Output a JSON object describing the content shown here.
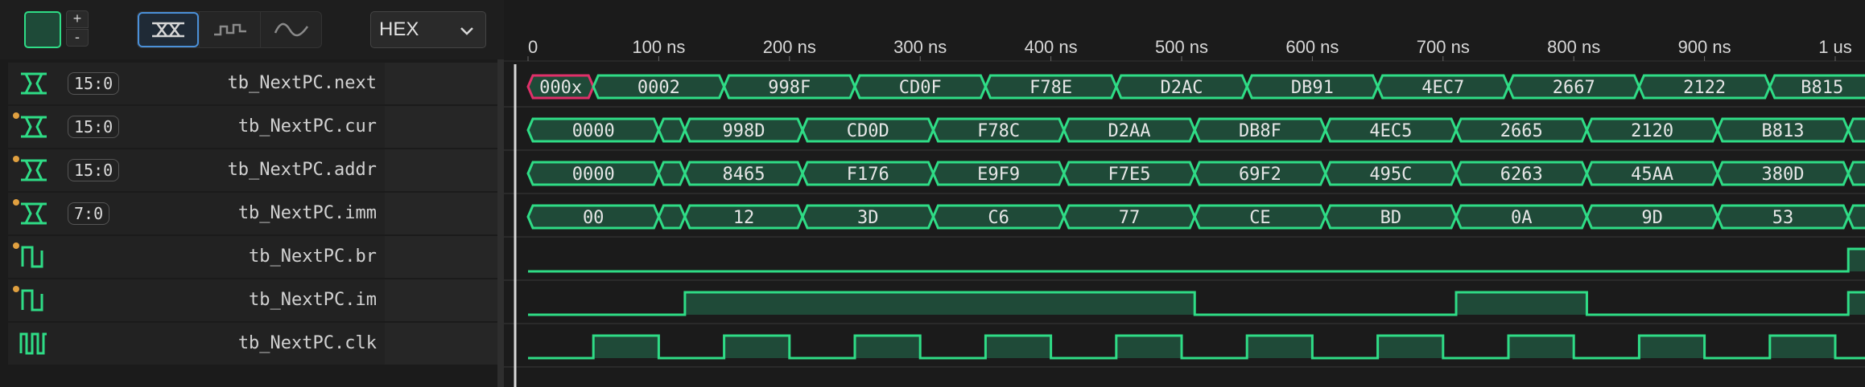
{
  "toolbar": {
    "plus": "+",
    "minus": "-",
    "radix": "HEX",
    "modes": [
      "bus-icon",
      "step-icon",
      "analog-icon"
    ]
  },
  "colors": {
    "wave": "#2fdc86",
    "wave_fill": "#1f4a38",
    "highlight": "#e0306a",
    "cursor": "#d8d8d8",
    "dot": "#e0a040"
  },
  "timeline": {
    "unit": "ns",
    "start": 0,
    "end": 1000,
    "ticks": [
      "0",
      "100 ns",
      "200 ns",
      "300 ns",
      "400 ns",
      "500 ns",
      "600 ns",
      "700 ns",
      "800 ns",
      "900 ns",
      "1 us"
    ]
  },
  "signals": [
    {
      "name": "tb_NextPC.next",
      "range": "15:0",
      "type": "bus",
      "dot": false,
      "segments": [
        [
          0,
          50,
          "000x"
        ],
        [
          50,
          150,
          "0002"
        ],
        [
          150,
          250,
          "998F"
        ],
        [
          250,
          350,
          "CD0F"
        ],
        [
          350,
          450,
          "F78E"
        ],
        [
          450,
          550,
          "D2AC"
        ],
        [
          550,
          650,
          "DB91"
        ],
        [
          650,
          750,
          "4EC7"
        ],
        [
          750,
          850,
          "2667"
        ],
        [
          850,
          950,
          "2122"
        ],
        [
          950,
          1030,
          "B815"
        ]
      ]
    },
    {
      "name": "tb_NextPC.cur",
      "range": "15:0",
      "type": "bus",
      "dot": true,
      "segments": [
        [
          0,
          100,
          "0000"
        ],
        [
          100,
          120,
          ""
        ],
        [
          120,
          210,
          "998D"
        ],
        [
          210,
          310,
          "CD0D"
        ],
        [
          310,
          410,
          "F78C"
        ],
        [
          410,
          510,
          "D2AA"
        ],
        [
          510,
          610,
          "DB8F"
        ],
        [
          610,
          710,
          "4EC5"
        ],
        [
          710,
          810,
          "2665"
        ],
        [
          810,
          910,
          "2120"
        ],
        [
          910,
          1010,
          "B813"
        ],
        [
          1010,
          1030,
          ""
        ]
      ]
    },
    {
      "name": "tb_NextPC.addr",
      "range": "15:0",
      "type": "bus",
      "dot": true,
      "segments": [
        [
          0,
          100,
          "0000"
        ],
        [
          100,
          120,
          ""
        ],
        [
          120,
          210,
          "8465"
        ],
        [
          210,
          310,
          "F176"
        ],
        [
          310,
          410,
          "E9F9"
        ],
        [
          410,
          510,
          "F7E5"
        ],
        [
          510,
          610,
          "69F2"
        ],
        [
          610,
          710,
          "495C"
        ],
        [
          710,
          810,
          "6263"
        ],
        [
          810,
          910,
          "45AA"
        ],
        [
          910,
          1010,
          "380D"
        ],
        [
          1010,
          1030,
          ""
        ]
      ]
    },
    {
      "name": "tb_NextPC.imm",
      "range": "7:0",
      "type": "bus",
      "dot": true,
      "segments": [
        [
          0,
          100,
          "00"
        ],
        [
          100,
          120,
          ""
        ],
        [
          120,
          210,
          "12"
        ],
        [
          210,
          310,
          "3D"
        ],
        [
          310,
          410,
          "C6"
        ],
        [
          410,
          510,
          "77"
        ],
        [
          510,
          610,
          "CE"
        ],
        [
          610,
          710,
          "BD"
        ],
        [
          710,
          810,
          "0A"
        ],
        [
          810,
          910,
          "9D"
        ],
        [
          910,
          1010,
          "53"
        ],
        [
          1010,
          1030,
          ""
        ]
      ]
    },
    {
      "name": "tb_NextPC.br",
      "range": "",
      "type": "bit",
      "dot": true,
      "transitions": [
        [
          0,
          0
        ],
        [
          1010,
          1
        ]
      ]
    },
    {
      "name": "tb_NextPC.im",
      "range": "",
      "type": "bit",
      "dot": true,
      "transitions": [
        [
          0,
          0
        ],
        [
          120,
          1
        ],
        [
          510,
          0
        ],
        [
          710,
          1
        ],
        [
          810,
          0
        ],
        [
          1010,
          1
        ]
      ]
    },
    {
      "name": "tb_NextPC.clk",
      "range": "",
      "type": "clock",
      "dot": false,
      "transitions": [
        [
          0,
          0
        ],
        [
          50,
          1
        ],
        [
          100,
          0
        ],
        [
          150,
          1
        ],
        [
          200,
          0
        ],
        [
          250,
          1
        ],
        [
          300,
          0
        ],
        [
          350,
          1
        ],
        [
          400,
          0
        ],
        [
          450,
          1
        ],
        [
          500,
          0
        ],
        [
          550,
          1
        ],
        [
          600,
          0
        ],
        [
          650,
          1
        ],
        [
          700,
          0
        ],
        [
          750,
          1
        ],
        [
          800,
          0
        ],
        [
          850,
          1
        ],
        [
          900,
          0
        ],
        [
          950,
          1
        ],
        [
          1000,
          0
        ],
        [
          1030,
          0
        ]
      ]
    }
  ]
}
